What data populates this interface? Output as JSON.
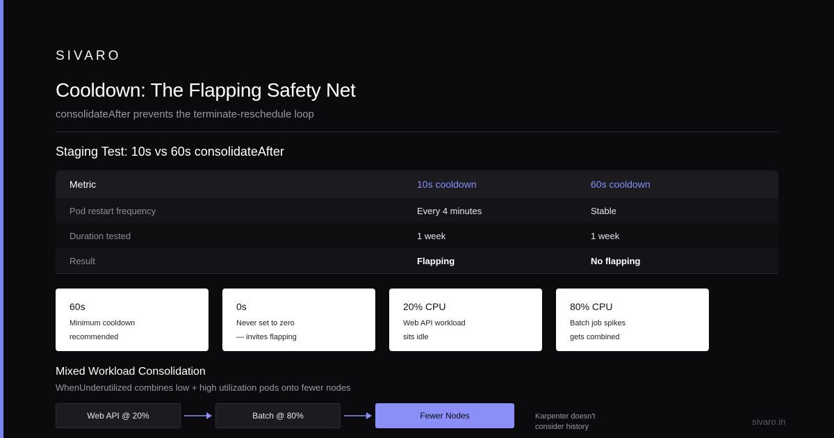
{
  "brand": "SIVARO",
  "header": {
    "title": "Cooldown: The Flapping Safety Net",
    "subtitle": "consolidateAfter prevents the terminate-reschedule loop"
  },
  "section": {
    "title": "Staging Test: 10s vs 60s consolidateAfter"
  },
  "table": {
    "headers": [
      "Metric",
      "10s cooldown",
      "60s cooldown"
    ],
    "rows": [
      [
        "Pod restart frequency",
        "Every 4 minutes",
        "Stable"
      ],
      [
        "Duration tested",
        "1 week",
        "1 week"
      ],
      [
        "Result",
        "Flapping",
        "No flapping"
      ]
    ]
  },
  "cards": [
    {
      "value": "60s",
      "line1": "Minimum cooldown",
      "line2": "recommended"
    },
    {
      "value": "0s",
      "line1": "Never set to zero",
      "line2": "— invites flapping"
    },
    {
      "value": "20% CPU",
      "line1": "Web API workload",
      "line2": "sits idle"
    },
    {
      "value": "80% CPU",
      "line1": "Batch job spikes",
      "line2": "gets combined"
    }
  ],
  "mixed": {
    "title": "Mixed Workload Consolidation",
    "subtitle": "WhenUnderutilized combines low + high utilization pods onto fewer nodes"
  },
  "flow": {
    "steps": [
      "Web API @ 20%",
      "Batch @ 80%",
      "Fewer Nodes"
    ],
    "note_line1": "Karpenter doesn't",
    "note_line2": "consider history"
  },
  "footer": "sivaro.in",
  "colors": {
    "accent": "#8a8ff7",
    "background": "#0b0b0d"
  }
}
